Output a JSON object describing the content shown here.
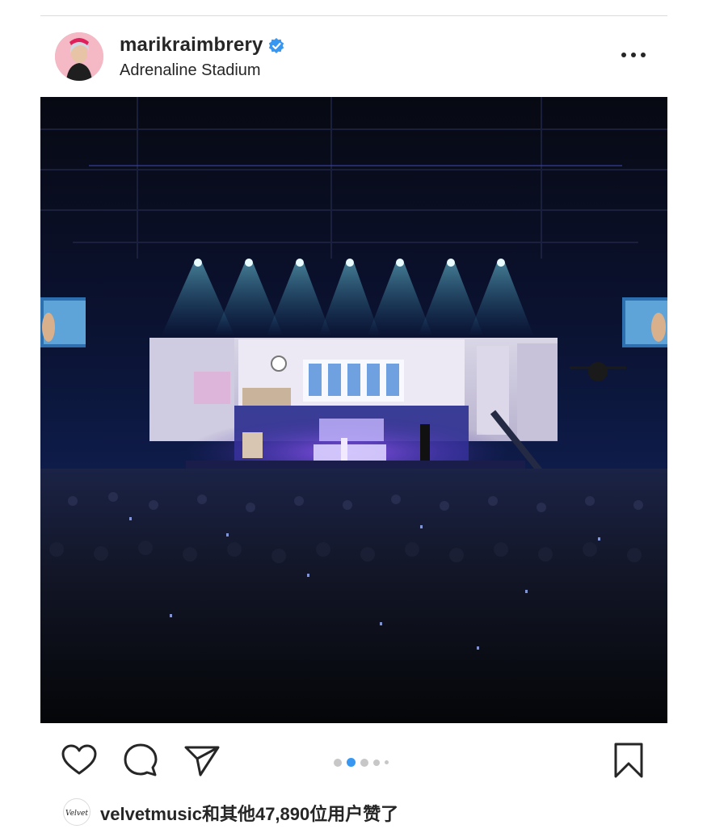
{
  "post": {
    "username": "marikraimbrery",
    "location": "Adrenaline Stadium",
    "verified": true,
    "carousel": {
      "total": 5,
      "active_index": 1
    },
    "likes_text": "velvetmusic和其他47,890位用户赞了",
    "liker_avatar_text": "Velvet"
  },
  "icons": {
    "verified": "verified-badge-icon",
    "more": "more-options-icon",
    "like": "heart-icon",
    "comment": "comment-bubble-icon",
    "share": "paper-plane-icon",
    "save": "bookmark-icon"
  },
  "colors": {
    "verified_blue": "#3897f0",
    "active_dot": "#3897f0",
    "inactive_dot": "#c7c7c7",
    "text": "#262626"
  }
}
